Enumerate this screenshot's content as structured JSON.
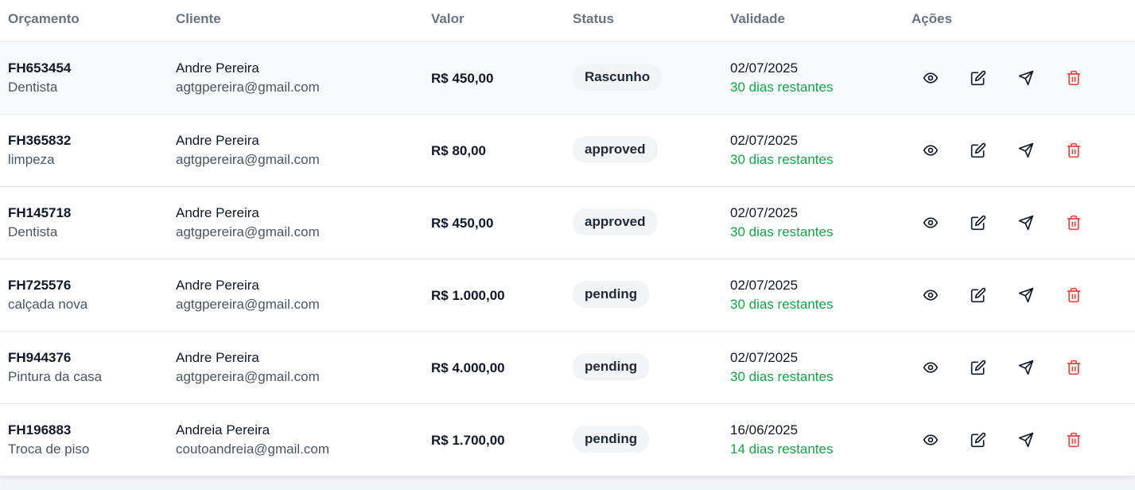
{
  "headers": {
    "orcamento": "Orçamento",
    "cliente": "Cliente",
    "valor": "Valor",
    "status": "Status",
    "validade": "Validade",
    "acoes": "Ações"
  },
  "rows": [
    {
      "id": "FH653454",
      "descricao": "Dentista",
      "cliente": "Andre Pereira",
      "email": "agtgpereira@gmail.com",
      "valor": "R$ 450,00",
      "status": "Rascunho",
      "data": "02/07/2025",
      "restante": "30 dias restantes"
    },
    {
      "id": "FH365832",
      "descricao": "limpeza",
      "cliente": "Andre Pereira",
      "email": "agtgpereira@gmail.com",
      "valor": "R$ 80,00",
      "status": "approved",
      "data": "02/07/2025",
      "restante": "30 dias restantes"
    },
    {
      "id": "FH145718",
      "descricao": "Dentista",
      "cliente": "Andre Pereira",
      "email": "agtgpereira@gmail.com",
      "valor": "R$ 450,00",
      "status": "approved",
      "data": "02/07/2025",
      "restante": "30 dias restantes"
    },
    {
      "id": "FH725576",
      "descricao": "calçada nova",
      "cliente": "Andre Pereira",
      "email": "agtgpereira@gmail.com",
      "valor": "R$ 1.000,00",
      "status": "pending",
      "data": "02/07/2025",
      "restante": "30 dias restantes"
    },
    {
      "id": "FH944376",
      "descricao": "Pintura da casa",
      "cliente": "Andre Pereira",
      "email": "agtgpereira@gmail.com",
      "valor": "R$ 4.000,00",
      "status": "pending",
      "data": "02/07/2025",
      "restante": "30 dias restantes"
    },
    {
      "id": "FH196883",
      "descricao": "Troca de piso",
      "cliente": "Andreia Pereira",
      "email": "coutoandreia@gmail.com",
      "valor": "R$ 1.700,00",
      "status": "pending",
      "data": "16/06/2025",
      "restante": "14 dias restantes"
    }
  ],
  "actions": [
    "eye-icon",
    "edit-icon",
    "send-icon",
    "trash-icon"
  ],
  "colors": {
    "remaining": "#16a34a",
    "delete": "#ef4444",
    "badge_bg": "#f3f4f6"
  }
}
